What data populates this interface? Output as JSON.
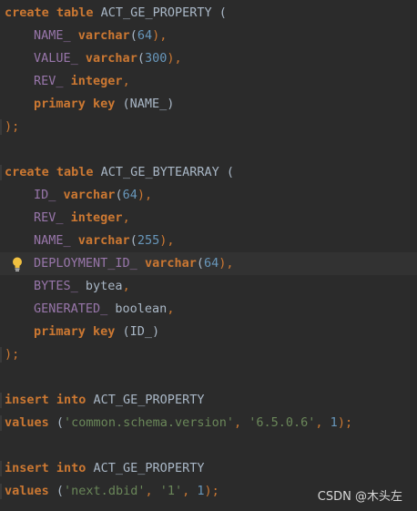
{
  "code": {
    "l1": {
      "a": "create table",
      "b": " ACT_GE_PROPERTY ("
    },
    "l2": {
      "f": "NAME_",
      "t": "varchar",
      "p1": "(",
      "n": "64",
      "p2": "),"
    },
    "l3": {
      "f": "VALUE_",
      "t": "varchar",
      "p1": "(",
      "n": "300",
      "p2": "),"
    },
    "l4": {
      "f": "REV_",
      "t": "integer",
      "p": ","
    },
    "l5": {
      "k": "primary key",
      "p": " (NAME_)"
    },
    "l6": {
      "p": ");"
    },
    "l8": {
      "a": "create table",
      "b": " ACT_GE_BYTEARRAY ("
    },
    "l9": {
      "f": "ID_",
      "t": "varchar",
      "p1": "(",
      "n": "64",
      "p2": "),"
    },
    "l10": {
      "f": "REV_",
      "t": "integer",
      "p": ","
    },
    "l11": {
      "f": "NAME_",
      "t": "varchar",
      "p1": "(",
      "n": "255",
      "p2": "),"
    },
    "l12": {
      "f": "DEPLOYMENT_ID_",
      "t": "varchar",
      "p1": "(",
      "n": "64",
      "p2": "),"
    },
    "l13": {
      "f": "BYTES_",
      "t": " bytea",
      "p": ","
    },
    "l14": {
      "f": "GENERATED_",
      "t": " boolean",
      "p": ","
    },
    "l15": {
      "k": "primary key",
      "p": " (ID_)"
    },
    "l16": {
      "p": ");"
    },
    "l18": {
      "a": "insert into",
      "b": " ACT_GE_PROPERTY"
    },
    "l19": {
      "a": "values",
      "p1": " (",
      "s1": "'common.schema.version'",
      "c1": ", ",
      "s2": "'6.5.0.6'",
      "c2": ", ",
      "n": "1",
      "p2": ");"
    },
    "l21": {
      "a": "insert into",
      "b": " ACT_GE_PROPERTY"
    },
    "l22": {
      "a": "values",
      "p1": " (",
      "s1": "'next.dbid'",
      "c1": ", ",
      "s2": "'1'",
      "c2": ", ",
      "n": "1",
      "p2": ");"
    }
  },
  "watermark": "CSDN @木头左",
  "icons": {
    "bulb": "lightbulb-icon"
  }
}
